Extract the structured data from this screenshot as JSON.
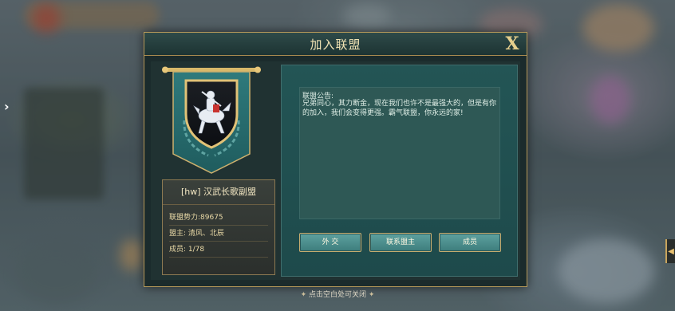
{
  "dialog": {
    "title": "加入联盟",
    "close_label": "X"
  },
  "guild": {
    "name": "[hw] 汉武长歌副盟",
    "power": "联盟势力:89675",
    "leader": "盟主: 清风、北辰",
    "members": "成员: 1/78"
  },
  "notice": {
    "title": "联盟公告:",
    "text": "兄弟同心，其力断金，现在我们也许不是最强大的，但是有你的加入，我们会变得更强。霸气联盟，你永远的家!"
  },
  "buttons": {
    "diplomacy": "外 交",
    "contact_leader": "联系盟主",
    "members": "成员"
  },
  "footer_hint": "点击空白处可关闭",
  "colors": {
    "gold": "#c7ad70",
    "teal_panel": "#235555",
    "button": "#4a8f8d"
  }
}
